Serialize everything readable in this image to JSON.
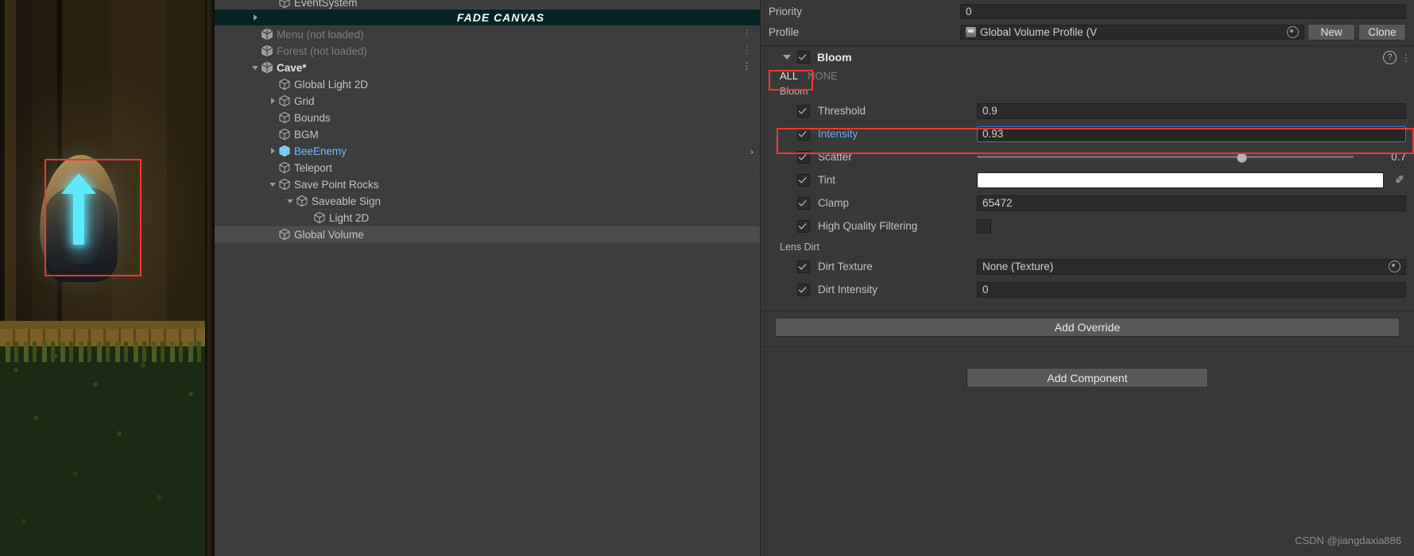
{
  "game_view": {
    "name": "scene-game-view",
    "annotation": "save-point-rock-highlight"
  },
  "hierarchy": {
    "rows": [
      {
        "label": "EventSystem",
        "indent": 2,
        "arrow": "none",
        "icon": "gameobject-icon",
        "state": "normal",
        "clipped": true
      },
      {
        "label": "FADE CANVAS",
        "indent": 1,
        "arrow": "right",
        "icon": "none",
        "state": "fade-banner"
      },
      {
        "label": "Menu (not loaded)",
        "indent": 1,
        "arrow": "none",
        "icon": "scene-icon",
        "state": "dim",
        "menu": true
      },
      {
        "label": "Forest (not loaded)",
        "indent": 1,
        "arrow": "none",
        "icon": "scene-icon",
        "state": "dim",
        "menu": true
      },
      {
        "label": "Cave*",
        "indent": 1,
        "arrow": "down",
        "icon": "scene-icon",
        "state": "bold",
        "menu": true
      },
      {
        "label": "Global Light 2D",
        "indent": 2,
        "arrow": "none",
        "icon": "gameobject-icon",
        "state": "normal"
      },
      {
        "label": "Grid",
        "indent": 2,
        "arrow": "right",
        "icon": "gameobject-icon",
        "state": "normal"
      },
      {
        "label": "Bounds",
        "indent": 2,
        "arrow": "none",
        "icon": "gameobject-icon",
        "state": "normal"
      },
      {
        "label": "BGM",
        "indent": 2,
        "arrow": "none",
        "icon": "gameobject-icon",
        "state": "normal"
      },
      {
        "label": "BeeEnemy",
        "indent": 2,
        "arrow": "right",
        "icon": "prefab-icon",
        "state": "prefab",
        "chevron": true
      },
      {
        "label": "Teleport",
        "indent": 2,
        "arrow": "none",
        "icon": "gameobject-icon",
        "state": "normal"
      },
      {
        "label": "Save Point Rocks",
        "indent": 2,
        "arrow": "down",
        "icon": "gameobject-icon",
        "state": "normal"
      },
      {
        "label": "Saveable Sign",
        "indent": 3,
        "arrow": "down",
        "icon": "gameobject-icon",
        "state": "normal"
      },
      {
        "label": "Light 2D",
        "indent": 4,
        "arrow": "none",
        "icon": "gameobject-icon",
        "state": "normal"
      },
      {
        "label": "Global Volume",
        "indent": 2,
        "arrow": "none",
        "icon": "gameobject-icon",
        "state": "selected"
      }
    ]
  },
  "inspector": {
    "priority": {
      "label": "Priority",
      "value": "0"
    },
    "profile": {
      "label": "Profile",
      "value": "Global Volume Profile (V",
      "new_button": "New",
      "clone_button": "Clone"
    },
    "bloom": {
      "title": "Bloom",
      "enabled": true,
      "all_label": "ALL",
      "none_label": "NONE",
      "section_label": "Bloom",
      "help_icon": "?",
      "properties": [
        {
          "name": "Threshold",
          "value": "0.9",
          "type": "text",
          "checked": true,
          "highlight": false
        },
        {
          "name": "Intensity",
          "value": "0.93",
          "type": "text",
          "checked": true,
          "highlight": true
        },
        {
          "name": "Scatter",
          "value": "0.7",
          "type": "slider",
          "checked": true,
          "highlight": false,
          "slider_percent": 70
        },
        {
          "name": "Tint",
          "value": "",
          "type": "color",
          "checked": true,
          "highlight": false,
          "color": "#ffffff"
        },
        {
          "name": "Clamp",
          "value": "65472",
          "type": "text",
          "checked": true,
          "highlight": false
        },
        {
          "name": "High Quality Filtering",
          "value": "",
          "type": "checkbox",
          "checked": true,
          "highlight": false,
          "box_checked": false
        }
      ],
      "lens_dirt": {
        "section_label": "Lens Dirt",
        "properties": [
          {
            "name": "Dirt Texture",
            "value": "None (Texture)",
            "type": "object",
            "checked": true
          },
          {
            "name": "Dirt Intensity",
            "value": "0",
            "type": "text",
            "checked": true
          }
        ]
      }
    },
    "add_override": "Add Override",
    "add_component": "Add Component"
  },
  "watermark": "CSDN @jiangdaxia886",
  "colors": {
    "accent_blue": "#6fa8ef",
    "annotation_red": "#f2372f",
    "panel_bg": "#383838",
    "hierarchy_bg": "#3c3c3c",
    "fade_banner_bg": "#042424"
  }
}
